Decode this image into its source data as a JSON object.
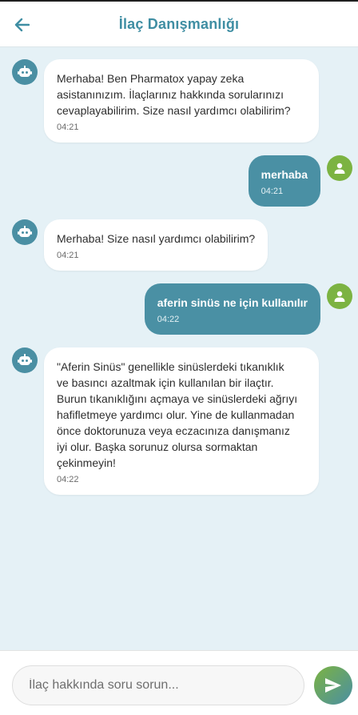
{
  "header": {
    "title": "İlaç Danışmanlığı",
    "back_icon": "arrow-left-icon"
  },
  "messages": [
    {
      "sender": "bot",
      "text": "Merhaba! Ben Pharmatox yapay zeka\nasistanınızım. İlaçlarınız hakkında sorularınızı\ncevaplayabilirim. Size nasıl yardımcı olabilirim?",
      "time": "04:21"
    },
    {
      "sender": "user",
      "text": "merhaba",
      "time": "04:21"
    },
    {
      "sender": "bot",
      "text": "Merhaba! Size nasıl yardımcı olabilirim?",
      "time": "04:21"
    },
    {
      "sender": "user",
      "text": "aferin sinüs ne için kullanılır",
      "time": "04:22"
    },
    {
      "sender": "bot",
      "text": "\"Aferin Sinüs\" genellikle sinüslerdeki tıkanıklık\nve basıncı azaltmak için kullanılan bir ilaçtır.\nBurun tıkanıklığını açmaya ve sinüslerdeki ağrıyı\nhafifletmeye yardımcı olur. Yine de kullanmadan\nönce doktorunuza veya eczacınıza danışmanız\niyi olur. Başka sorunuz olursa sormaktan\nçekinmeyin!",
      "time": "04:22"
    }
  ],
  "input": {
    "placeholder": "İlaç hakkında soru sorun...",
    "value": ""
  },
  "icons": {
    "bot": "robot-icon",
    "user": "person-icon",
    "send": "send-icon"
  },
  "colors": {
    "accent": "#4a90a4",
    "user_avatar": "#7cb342",
    "background": "#e5f1f6",
    "title": "#3f8ea3"
  }
}
